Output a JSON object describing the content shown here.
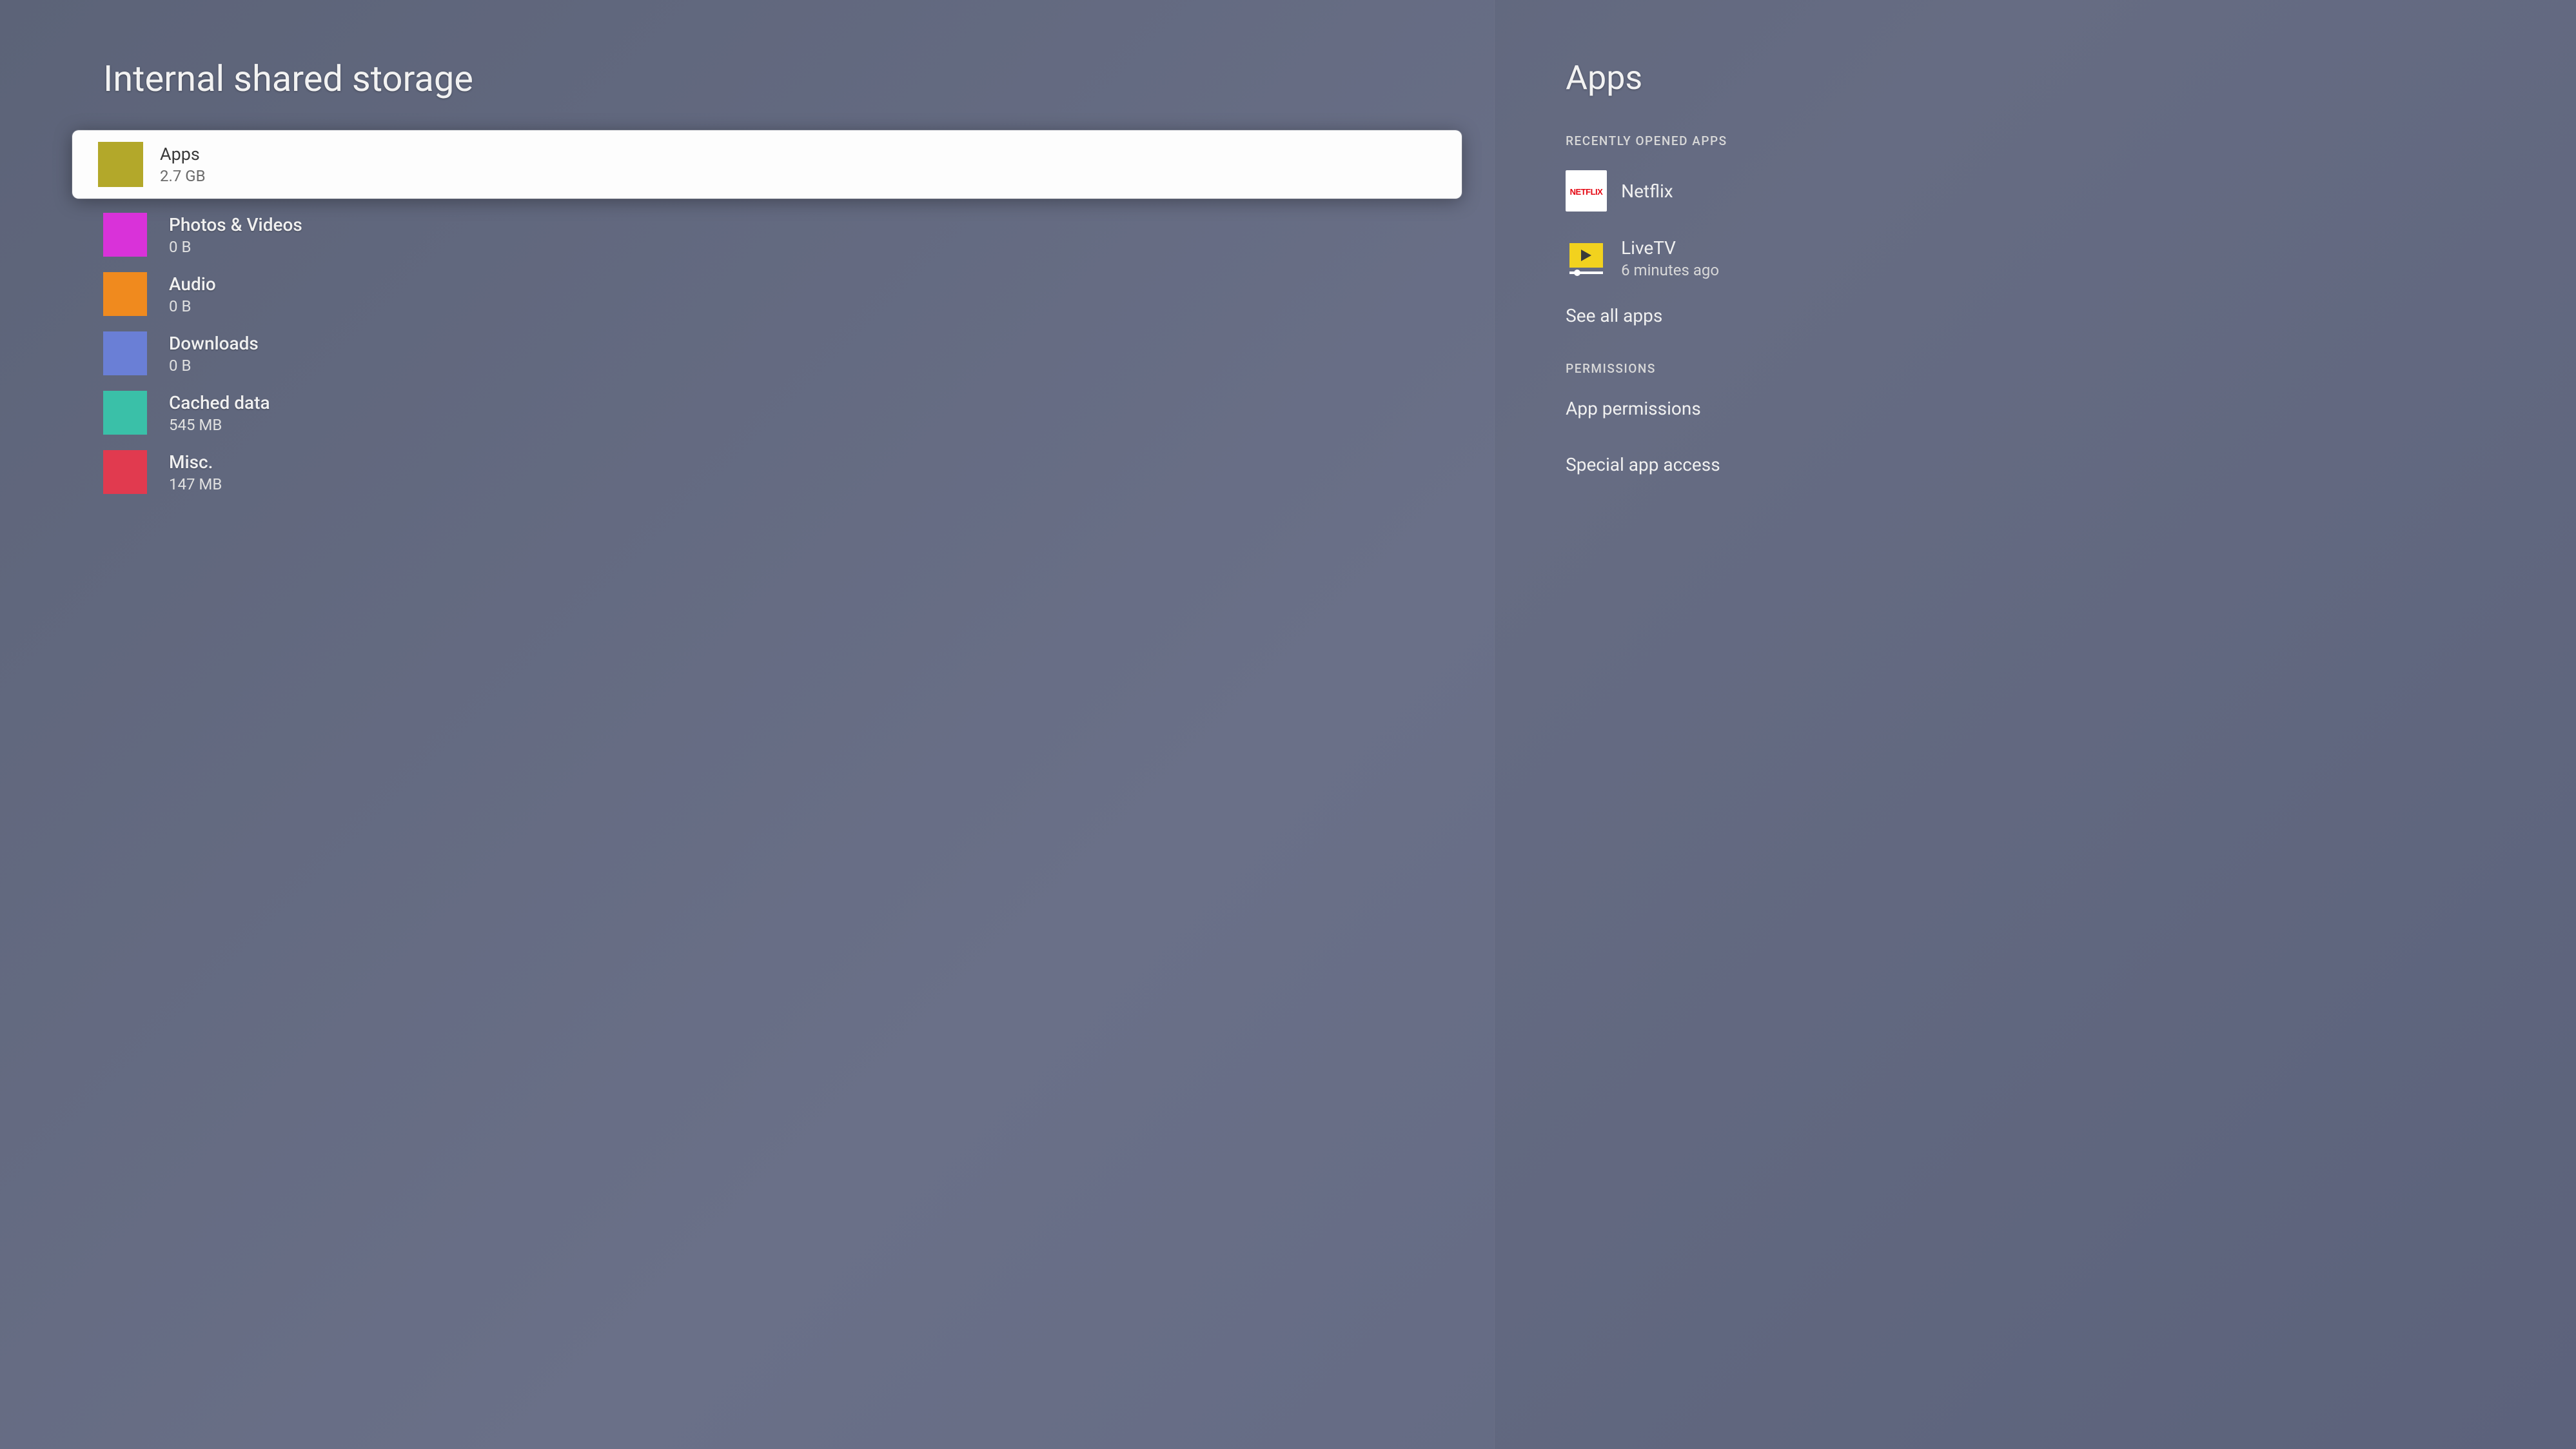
{
  "left": {
    "title": "Internal shared storage",
    "items": [
      {
        "label": "Apps",
        "value": "2.7 GB",
        "color": "#b3a82a",
        "selected": true
      },
      {
        "label": "Photos & Videos",
        "value": "0 B",
        "color": "#d932d9",
        "selected": false
      },
      {
        "label": "Audio",
        "value": "0 B",
        "color": "#f08a1e",
        "selected": false
      },
      {
        "label": "Downloads",
        "value": "0 B",
        "color": "#6a7fd6",
        "selected": false
      },
      {
        "label": "Cached data",
        "value": "545 MB",
        "color": "#3ac0a8",
        "selected": false
      },
      {
        "label": "Misc.",
        "value": "147 MB",
        "color": "#e13a4f",
        "selected": false
      }
    ]
  },
  "right": {
    "title": "Apps",
    "recent_header": "Recently opened apps",
    "recent_apps": [
      {
        "name": "Netflix",
        "sub": "",
        "icon": "netflix"
      },
      {
        "name": "LiveTV",
        "sub": "6 minutes ago",
        "icon": "livetv"
      }
    ],
    "see_all": "See all apps",
    "permissions_header": "Permissions",
    "permission_links": [
      "App permissions",
      "Special app access"
    ]
  }
}
